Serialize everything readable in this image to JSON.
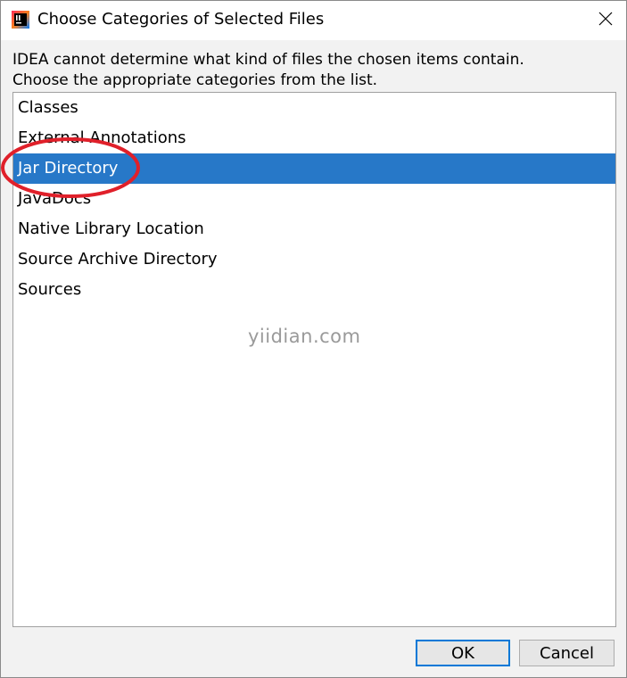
{
  "window": {
    "title": "Choose Categories of Selected Files",
    "app_icon": "intellij-idea-icon",
    "close_icon": "close-icon"
  },
  "message": {
    "line1": "IDEA cannot determine what kind of files the chosen items contain.",
    "line2": "Choose the appropriate categories from the list."
  },
  "categories": {
    "items": [
      {
        "label": "Classes",
        "selected": false
      },
      {
        "label": "External Annotations",
        "selected": false
      },
      {
        "label": "Jar Directory",
        "selected": true
      },
      {
        "label": "JavaDocs",
        "selected": false
      },
      {
        "label": "Native Library Location",
        "selected": false
      },
      {
        "label": "Source Archive Directory",
        "selected": false
      },
      {
        "label": "Sources",
        "selected": false
      }
    ]
  },
  "watermark": "yiidian.com",
  "buttons": {
    "ok": "OK",
    "cancel": "Cancel"
  },
  "colors": {
    "selection": "#2778c8",
    "annotation": "#e0202a",
    "default_button_border": "#0078d7"
  }
}
